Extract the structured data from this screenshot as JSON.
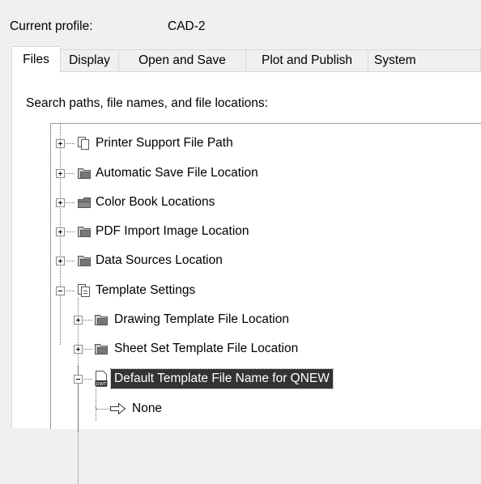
{
  "profile": {
    "label": "Current profile:",
    "value": "CAD-2"
  },
  "tabs": [
    {
      "label": "Files",
      "active": true
    },
    {
      "label": "Display",
      "active": false
    },
    {
      "label": "Open and Save",
      "active": false
    },
    {
      "label": "Plot and Publish",
      "active": false
    },
    {
      "label": "System",
      "active": false
    }
  ],
  "section_label": "Search paths, file names, and file locations:",
  "tree": [
    {
      "label": "Printer Support File Path",
      "icon": "printer-support-folder-icon",
      "state": "collapsed",
      "level": 0
    },
    {
      "label": "Automatic Save File Location",
      "icon": "folder-icon",
      "state": "collapsed",
      "level": 0
    },
    {
      "label": "Color Book Locations",
      "icon": "folder-icon",
      "state": "collapsed",
      "level": 0
    },
    {
      "label": "PDF Import Image Location",
      "icon": "folder-icon",
      "state": "collapsed",
      "level": 0
    },
    {
      "label": "Data Sources Location",
      "icon": "folder-icon",
      "state": "collapsed",
      "level": 0
    },
    {
      "label": "Template Settings",
      "icon": "template-settings-icon",
      "state": "expanded",
      "level": 0
    },
    {
      "label": "Drawing Template File Location",
      "icon": "folder-icon",
      "state": "collapsed",
      "level": 1
    },
    {
      "label": "Sheet Set Template File Location",
      "icon": "folder-icon",
      "state": "collapsed",
      "level": 1
    },
    {
      "label": "Default Template File Name for QNEW",
      "icon": "dwt-file-icon",
      "state": "expanded",
      "level": 1,
      "selected": true
    },
    {
      "label": "None",
      "icon": "arrow-right-icon",
      "state": "leaf",
      "level": 2
    }
  ],
  "colors": {
    "selection": "#333333",
    "tab_border": "#d9d9d9",
    "tree_border": "#9c9c9c"
  }
}
